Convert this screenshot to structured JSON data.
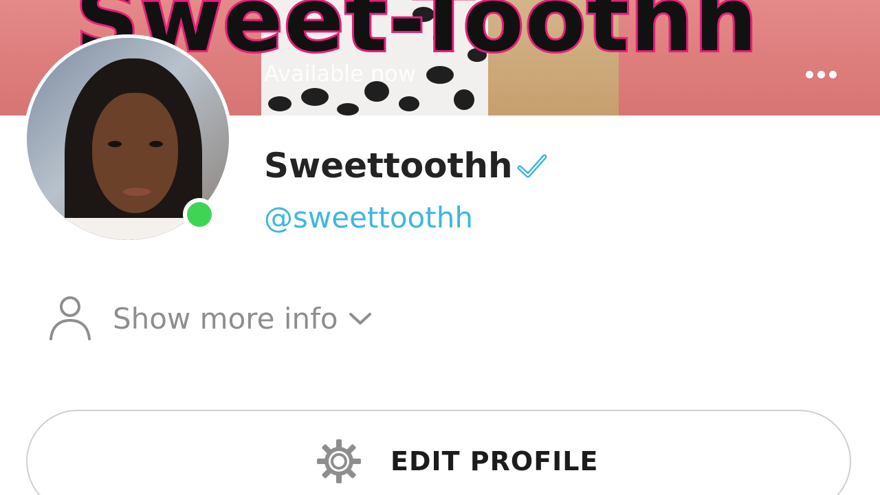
{
  "banner": {
    "title": "Sweet-Toothh",
    "status_text": "Available now",
    "more_icon": "more-horizontal-icon"
  },
  "profile": {
    "display_name": "Sweettoothh",
    "username": "@sweettoothh",
    "verified_icon": "verified-check-icon",
    "online_status_color": "#3ed454"
  },
  "info": {
    "label": "Show more info",
    "icon": "person-icon",
    "chevron_icon": "chevron-down-icon"
  },
  "actions": {
    "edit_profile_label": "EDIT PROFILE",
    "edit_profile_icon": "gear-icon"
  },
  "colors": {
    "username_accent": "#3fb6e0",
    "banner_text_outline": "#e81f79",
    "banner_background": "#dc7c7b"
  }
}
